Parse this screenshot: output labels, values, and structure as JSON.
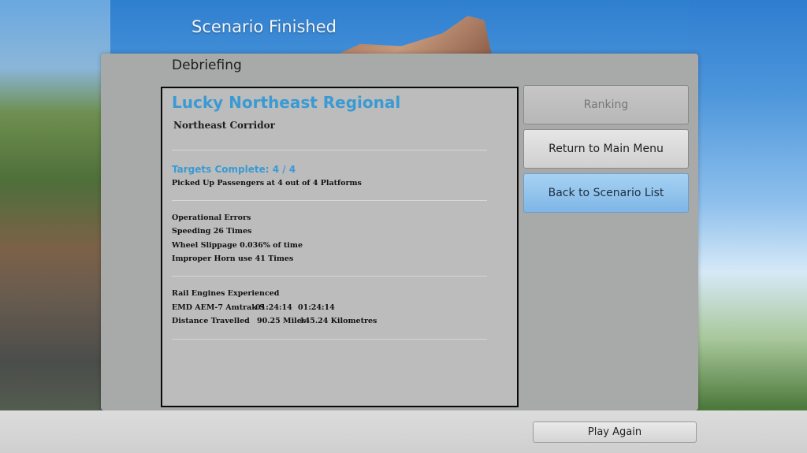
{
  "screen": {
    "title": "Scenario Finished"
  },
  "panel": {
    "title": "Debriefing"
  },
  "debrief": {
    "scenario_name": "Lucky Northeast Regional",
    "route_name": "Northeast Corridor",
    "targets_heading": "Targets Complete: 4 / 4",
    "targets_detail": "Picked Up Passengers at 4 out of 4 Platforms",
    "errors_heading": "Operational Errors",
    "errors": [
      "Speeding 26 Times",
      "Wheel Slippage 0.036% of time",
      "Improper Horn use 41 Times"
    ],
    "engines_heading": "Rail Engines Experienced",
    "engine_row": {
      "name": "EMD AEM-7 Amtrak S",
      "time_a": "01:24:14",
      "time_b": "01:24:14"
    },
    "distance_row": {
      "label": "Distance Travelled",
      "miles": "90.25 Miles",
      "km": "145.24 Kilometres"
    }
  },
  "buttons": {
    "ranking": "Ranking",
    "return_main_menu": "Return to Main Menu",
    "back_scenario_list": "Back to Scenario List",
    "play_again": "Play Again"
  }
}
